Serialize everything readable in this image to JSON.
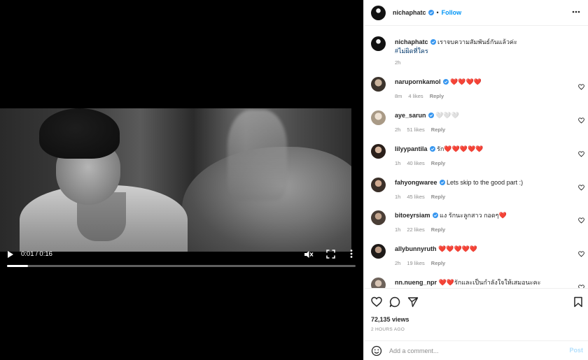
{
  "video": {
    "time_display": "0:01 / 0:16",
    "progress": 0.06
  },
  "post": {
    "owner": "nichaphatc",
    "follow_label": "Follow",
    "follow_separator": "•",
    "caption_text": "เราจบความสัมพันธ์กันแล้วค่ะ",
    "caption_hashtag": "#ไม่ผิดที่ใคร",
    "caption_age": "2h",
    "views": "72,135 views",
    "timestamp": "2 HOURS AGO"
  },
  "comments": [
    {
      "user": "narupornkamol",
      "verified": true,
      "text": "❤️❤️❤️❤️",
      "age": "8m",
      "likes": "4 likes",
      "reply": "Reply"
    },
    {
      "user": "aye_sarun",
      "verified": true,
      "text": "🤍🤍🤍",
      "age": "2h",
      "likes": "51 likes",
      "reply": "Reply"
    },
    {
      "user": "lilyypantila",
      "verified": true,
      "text": "รัก❤️❤️❤️❤️❤️",
      "age": "1h",
      "likes": "40 likes",
      "reply": "Reply"
    },
    {
      "user": "fahyongwaree",
      "verified": true,
      "text": "Lets skip to the good part :)",
      "age": "1h",
      "likes": "45 likes",
      "reply": "Reply"
    },
    {
      "user": "bitoeyrsiam",
      "verified": true,
      "text": "แง รักนะลูกสาว กอดๆ❤️",
      "age": "1h",
      "likes": "22 likes",
      "reply": "Reply"
    },
    {
      "user": "allybunnyruth",
      "verified": false,
      "text": "❤️❤️❤️❤️❤️",
      "age": "2h",
      "likes": "19 likes",
      "reply": "Reply"
    },
    {
      "user": "nn.nueng_npr",
      "verified": false,
      "text": "❤️❤️รักและเป็นกำลังใจให้เสมอนะคะ",
      "age": "",
      "likes": "",
      "reply": ""
    }
  ],
  "add_comment": {
    "placeholder": "Add a comment...",
    "post_label": "Post"
  },
  "colors": {
    "accent": "#0095f6",
    "verified": "#3897f0",
    "muted": "#8e8e8e",
    "post_disabled": "#b2dffc"
  },
  "icons": {
    "play": "play-icon",
    "mute": "muted-speaker-icon",
    "fullscreen": "fullscreen-icon",
    "video_more": "vertical-dots-icon",
    "header_more": "horizontal-dots-icon",
    "like": "heart-icon",
    "comment": "comment-bubble-icon",
    "share": "paper-plane-icon",
    "save": "bookmark-icon",
    "emoji": "smiley-icon"
  }
}
